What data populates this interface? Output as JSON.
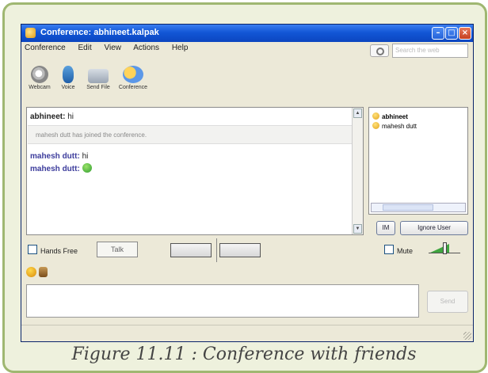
{
  "window": {
    "title": "Conference: abhineet.kalpak",
    "min_symbol": "–",
    "max_symbol": "□",
    "close_symbol": "×"
  },
  "menu": [
    "Conference",
    "Edit",
    "View",
    "Actions",
    "Help"
  ],
  "search": {
    "placeholder": "Search the web"
  },
  "toolbar": [
    {
      "label": "Webcam",
      "icon": "webcam-icon"
    },
    {
      "label": "Voice",
      "icon": "microphone-icon"
    },
    {
      "label": "Send File",
      "icon": "send-file-icon"
    },
    {
      "label": "Conference",
      "icon": "conference-icon"
    }
  ],
  "chat": {
    "messages": [
      {
        "sender": "abhineet:",
        "text": "hi"
      },
      {
        "sender": "mahesh dutt:",
        "text": "hi"
      },
      {
        "sender": "mahesh dutt:",
        "text": ""
      }
    ],
    "system_message": "mahesh dutt has joined the conference."
  },
  "users": {
    "list": [
      "abhineet",
      "mahesh dutt"
    ],
    "ignore_label": "Ignore User",
    "im_label": "IM"
  },
  "controls": {
    "hands_free_label": "Hands Free",
    "talk_label": "Talk",
    "mute_label": "Mute"
  },
  "send_label": "Send",
  "caption": "Figure 11.11 : Conference with friends",
  "colors": {
    "frame": "#9fb771",
    "titlebar": "#1257d6",
    "sender_other": "#3c3c9c"
  }
}
